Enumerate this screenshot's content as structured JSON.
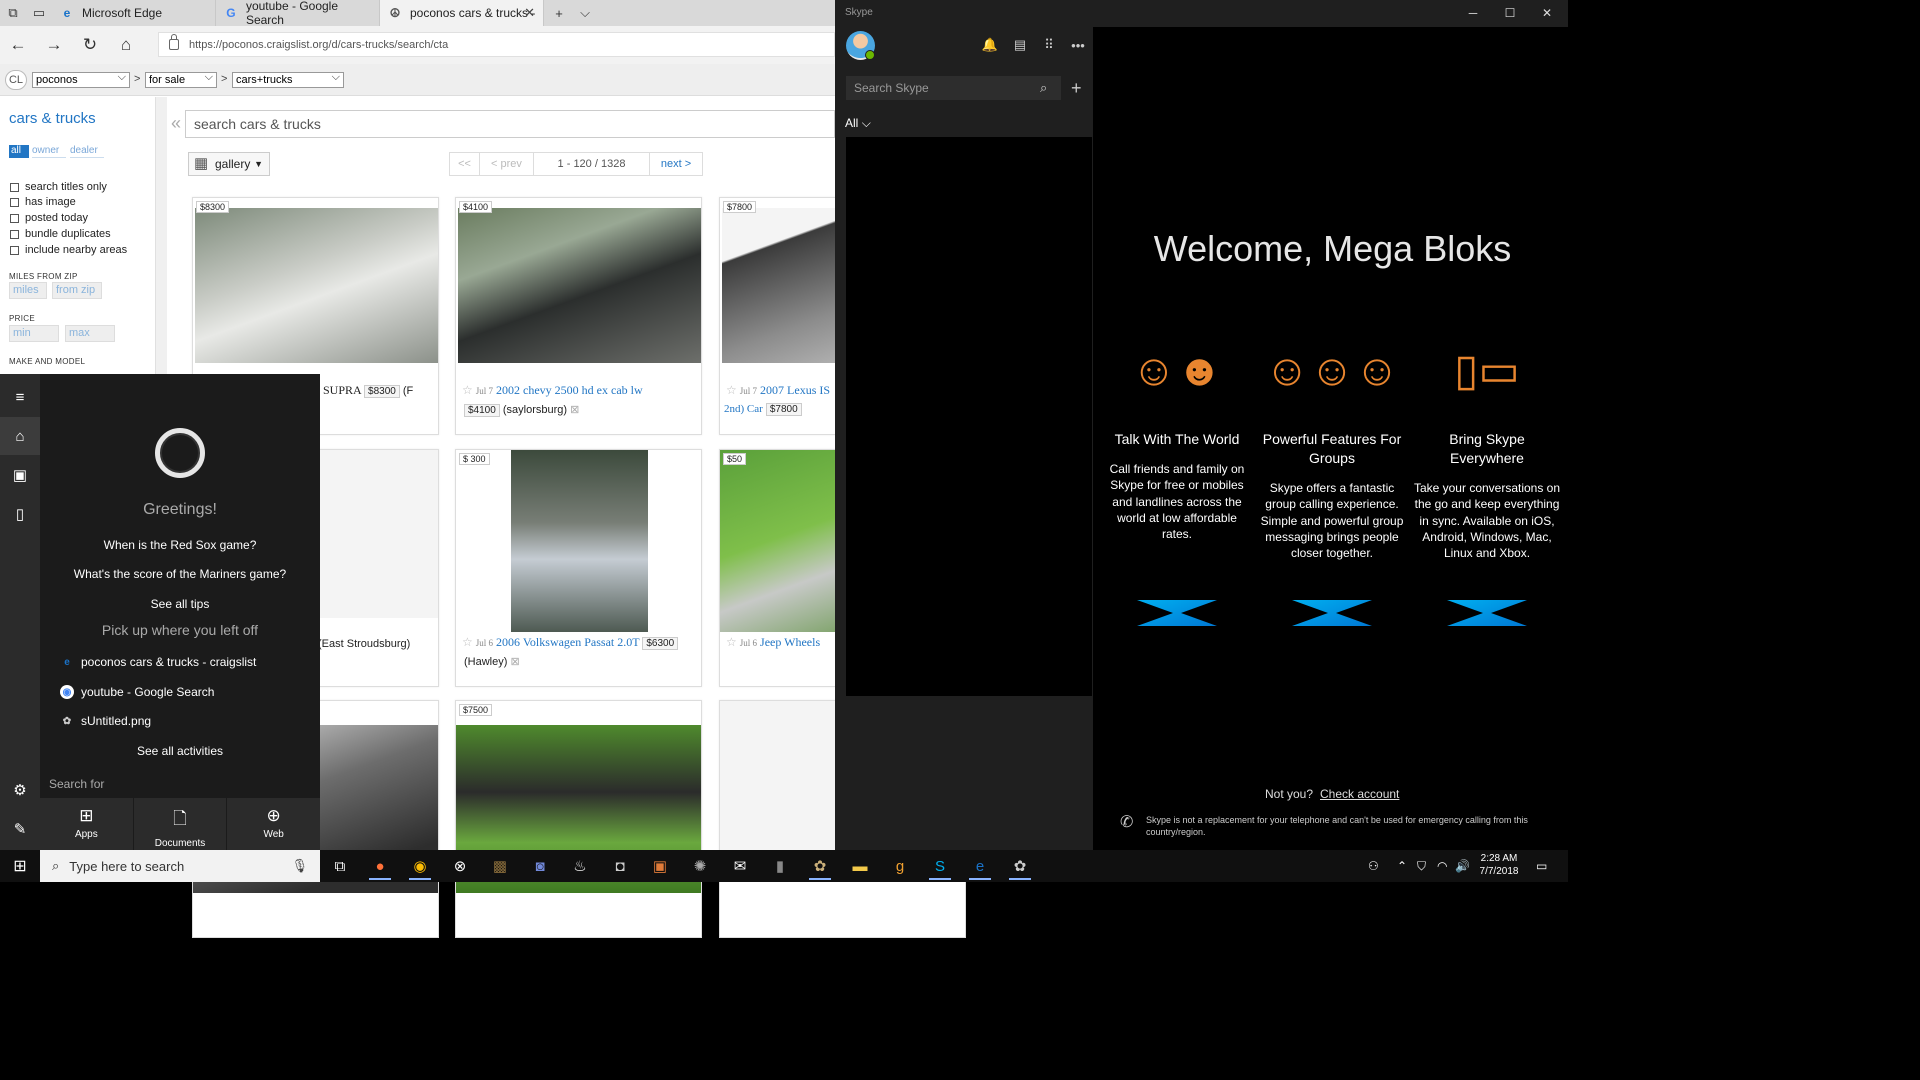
{
  "edge": {
    "tabs": [
      {
        "label": "Microsoft Edge"
      },
      {
        "label": "youtube - Google Search"
      },
      {
        "label": "poconos cars & trucks -"
      }
    ],
    "url": "https://poconos.craigslist.org/d/cars-trucks/search/cta"
  },
  "craigslist": {
    "logo": "CL",
    "breadcrumb": {
      "area": "poconos",
      "section": "for sale",
      "category": "cars+trucks",
      "sep": ">"
    },
    "sidebar": {
      "category": "cars & trucks",
      "chips": [
        "all",
        "owner",
        "dealer"
      ],
      "checks": [
        "search titles only",
        "has image",
        "posted today",
        "bundle duplicates",
        "include nearby areas"
      ],
      "miles_heading": "MILES FROM ZIP",
      "miles_placeholder": "miles",
      "zip_placeholder": "from zip",
      "price_heading": "PRICE",
      "min_placeholder": "min",
      "max_placeholder": "max",
      "make_heading": "MAKE AND MODEL"
    },
    "search_placeholder": "search cars & trucks",
    "collapse": "«",
    "view": "gallery",
    "pager": {
      "first": "<<",
      "prev": "< prev",
      "range": "1 - 120 / 1328",
      "next": "next >"
    },
    "listings": [
      {
        "tag": "$8300",
        "date": "",
        "title": "SUPRA",
        "price": "$8300",
        "loc": "(F"
      },
      {
        "tag": "$4100",
        "date": "Jul 7",
        "title": "2002 chevy 2500 hd ex cab lw",
        "price": "$4100",
        "loc": "(saylorsburg)"
      },
      {
        "tag": "$7800",
        "date": "Jul 7",
        "title": "2007 Lexus IS",
        "price": "$7800",
        "loc": "2nd) Car"
      },
      {
        "tag": "",
        "date": "",
        "title": "",
        "price": "",
        "loc": "(East Stroudsburg)"
      },
      {
        "tag": "$6300",
        "date": "Jul 6",
        "title": "2006 Volkswagen Passat 2.0T",
        "price": "$6300",
        "loc": "(Hawley)"
      },
      {
        "tag": "$50",
        "date": "Jul 6",
        "title": "Jeep Wheels",
        "price": "",
        "loc": ""
      },
      {
        "tag": "",
        "date": "",
        "title": "",
        "price": "",
        "loc": ""
      },
      {
        "tag": "$7500",
        "date": "",
        "title": "",
        "price": "",
        "loc": ""
      }
    ]
  },
  "cortana": {
    "greeting": "Greetings!",
    "tips": [
      "When is the Red Sox game?",
      "What's the score of the Mariners game?"
    ],
    "see_tips": "See all tips",
    "pickup": "Pick up where you left off",
    "activities": [
      "poconos cars & trucks - craigslist",
      "youtube - Google Search",
      "sUntitled.png"
    ],
    "see_activities": "See all activities",
    "search_for": "Search for",
    "scopes": [
      "Apps",
      "Documents",
      "Web"
    ]
  },
  "skype": {
    "window_title": "Skype",
    "search_placeholder": "Search Skype",
    "filter": "All",
    "welcome": "Welcome, Mega Bloks",
    "features": [
      {
        "title": "Talk With The World",
        "desc": "Call friends and family on Skype for free or mobiles and landlines across the world at low affordable rates."
      },
      {
        "title": "Powerful Features For Groups",
        "desc": "Skype offers a fantastic group calling experience. Simple and powerful group messaging brings people closer together."
      },
      {
        "title": "Bring Skype Everywhere",
        "desc": "Take your conversations on the go and keep everything in sync. Available on iOS, Android, Windows, Mac, Linux and Xbox."
      }
    ],
    "not_you": "Not you?",
    "check_account": "Check account",
    "disclaimer": "Skype is not a replacement for your telephone and can't be used for emergency calling from this country/region."
  },
  "taskbar": {
    "search_placeholder": "Type here to search",
    "time": "2:28 AM",
    "date": "7/7/2018"
  },
  "colors": {
    "cl_link": "#2276c4",
    "skype_accent": "#00aff0",
    "skype_orange": "#e8852f"
  }
}
